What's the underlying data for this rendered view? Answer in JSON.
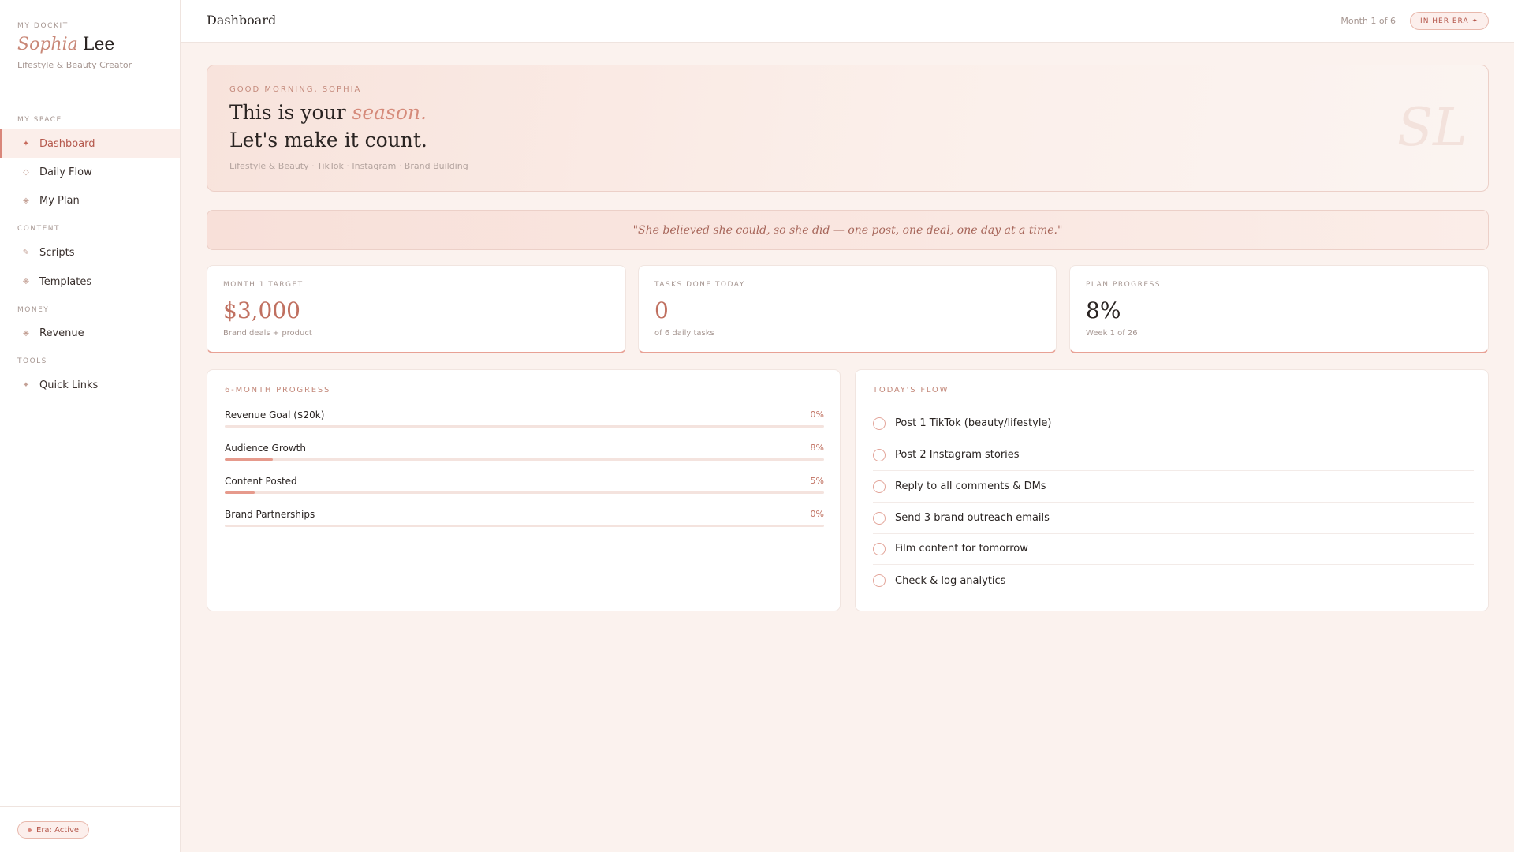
{
  "sidebar": {
    "kicker": "MY DOCKIT",
    "first_name": "Sophia",
    "last_name": "Lee",
    "role": "Lifestyle & Beauty Creator",
    "sections": {
      "my_space": "MY SPACE",
      "content": "CONTENT",
      "money": "MONEY",
      "tools": "TOOLS"
    },
    "items": {
      "dashboard": {
        "icon": "✦",
        "label": "Dashboard"
      },
      "daily_flow": {
        "icon": "◇",
        "label": "Daily Flow"
      },
      "my_plan": {
        "icon": "◈",
        "label": "My Plan"
      },
      "scripts": {
        "icon": "✎",
        "label": "Scripts"
      },
      "templates": {
        "icon": "❋",
        "label": "Templates"
      },
      "revenue": {
        "icon": "◈",
        "label": "Revenue"
      },
      "quick_links": {
        "icon": "✦",
        "label": "Quick Links"
      }
    },
    "active_item": "Dashboard",
    "footer_pill": "Era: Active"
  },
  "topbar": {
    "title": "Dashboard",
    "month": "Month 1 of 6",
    "badge": "IN HER ERA ✦"
  },
  "hero": {
    "greeting": "GOOD MORNING, SOPHIA",
    "line1_prefix": "This is your",
    "line1_accent": "season.",
    "line2": "Let's make it count.",
    "tags": "Lifestyle & Beauty · TikTok · Instagram · Brand Building",
    "monogram": "SL"
  },
  "quote": "\"She believed she could, so she did — one post, one deal, one day at a time.\"",
  "stats": [
    {
      "label": "MONTH 1 TARGET",
      "value": "$3,000",
      "sub": "Brand deals + product"
    },
    {
      "label": "TASKS DONE TODAY",
      "value": "0",
      "sub": "of 6 daily tasks"
    },
    {
      "label": "PLAN PROGRESS",
      "value": "8%",
      "sub": "Week 1 of 26"
    }
  ],
  "progress": {
    "title": "6-MONTH PROGRESS",
    "rows": [
      {
        "name": "Revenue Goal ($20k)",
        "pct": "0%",
        "value": 0
      },
      {
        "name": "Audience Growth",
        "pct": "8%",
        "value": 8
      },
      {
        "name": "Content Posted",
        "pct": "5%",
        "value": 5
      },
      {
        "name": "Brand Partnerships",
        "pct": "0%",
        "value": 0
      }
    ]
  },
  "flow": {
    "title": "TODAY'S FLOW",
    "tasks": [
      "Post 1 TikTok (beauty/lifestyle)",
      "Post 2 Instagram stories",
      "Reply to all comments & DMs",
      "Send 3 brand outreach emails",
      "Film content for tomorrow",
      "Check & log analytics"
    ]
  },
  "colors": {
    "accent": "#d9867a",
    "accent_dark": "#b5594d",
    "blush_bg": "#fbf2ee"
  }
}
